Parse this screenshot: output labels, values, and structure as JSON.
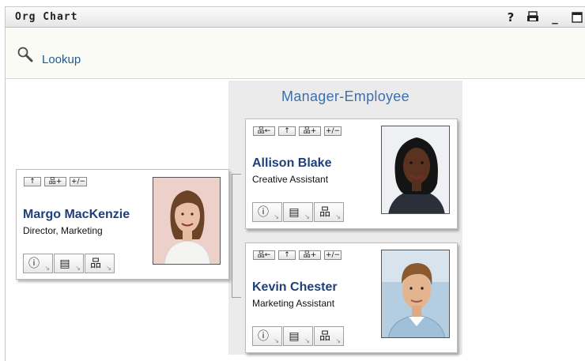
{
  "window": {
    "title": "Org Chart",
    "title_buttons": [
      {
        "name": "help-icon",
        "glyph": "?"
      },
      {
        "name": "print-icon",
        "glyph": "🖶"
      },
      {
        "name": "minimize-icon",
        "glyph": "_"
      },
      {
        "name": "maximize-icon",
        "glyph": "☐"
      }
    ]
  },
  "toolbar": {
    "lookup_label": "Lookup",
    "lookup_icon": "magnifier-icon"
  },
  "panel": {
    "title": "Manager-Employee"
  },
  "card_controls": {
    "show_manager_glyph": "品←",
    "up_glyph": "↑",
    "expand_glyph": "品+",
    "toggle_glyph": "+/−",
    "action_icons": [
      "info-icon",
      "email-card-icon",
      "org-chart-icon"
    ],
    "action_glyphs": [
      "ⓘ",
      "▤",
      "品"
    ],
    "action_arrow": "↘"
  },
  "manager": {
    "name": "Margo MacKenzie",
    "title": "Director, Marketing",
    "photo": "woman-portrait-photo"
  },
  "employees": [
    {
      "name": "Allison Blake",
      "title": "Creative Assistant",
      "photo": "woman-portrait-photo"
    },
    {
      "name": "Kevin Chester",
      "title": "Marketing Assistant",
      "photo": "man-portrait-photo"
    }
  ],
  "colors": {
    "name_link": "#1e3f7a",
    "panel_title": "#3c6fae",
    "lookup_link": "#1f5a9c",
    "panel_bg": "#ebebeb"
  }
}
